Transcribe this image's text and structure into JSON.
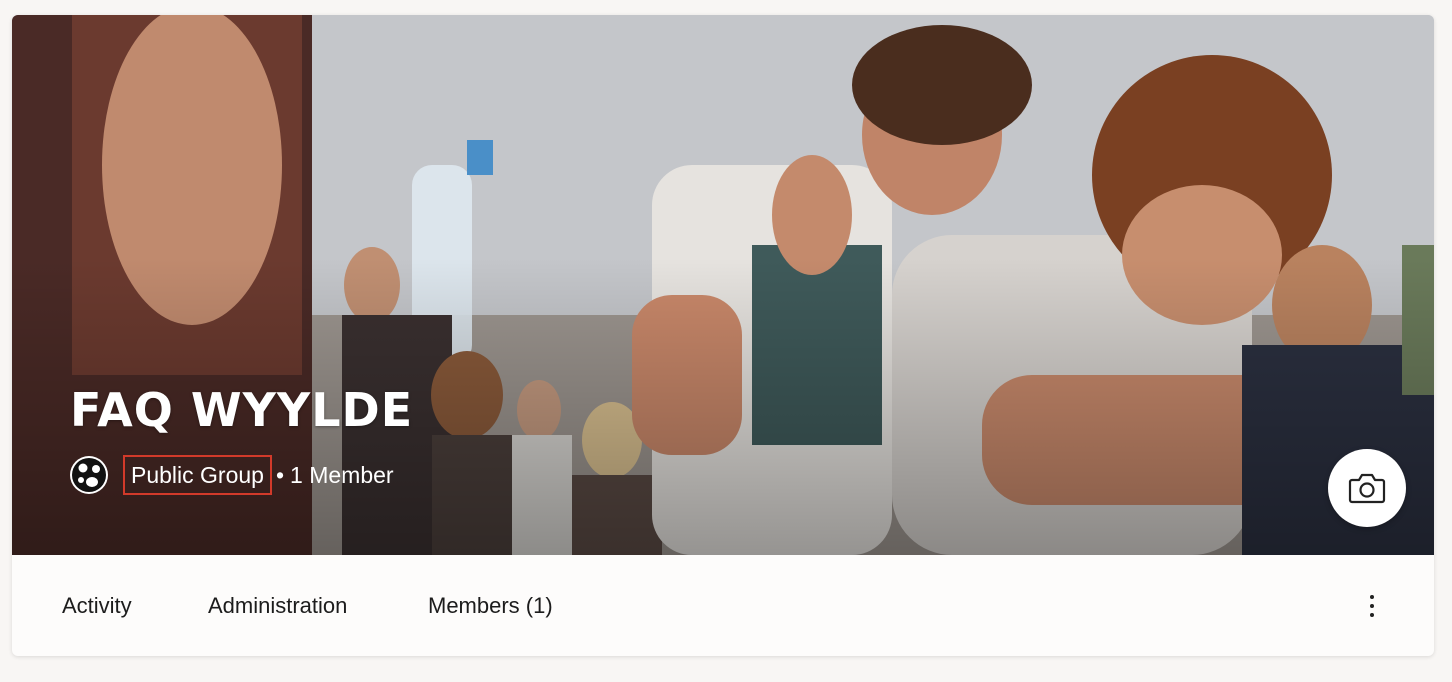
{
  "group": {
    "name": "FAQ WYYLDE",
    "privacy": "Public Group",
    "separator": "•",
    "members_text": "1 Member"
  },
  "cover": {
    "icon": "camera-icon"
  },
  "nav": {
    "tabs": [
      {
        "label": "Activity"
      },
      {
        "label": "Administration"
      },
      {
        "label": "Members (1)"
      }
    ],
    "more_icon": "more-vertical-icon"
  },
  "colors": {
    "highlight": "#d23a2a",
    "title": "#ffffff",
    "tab_text": "#1c1c1c"
  }
}
